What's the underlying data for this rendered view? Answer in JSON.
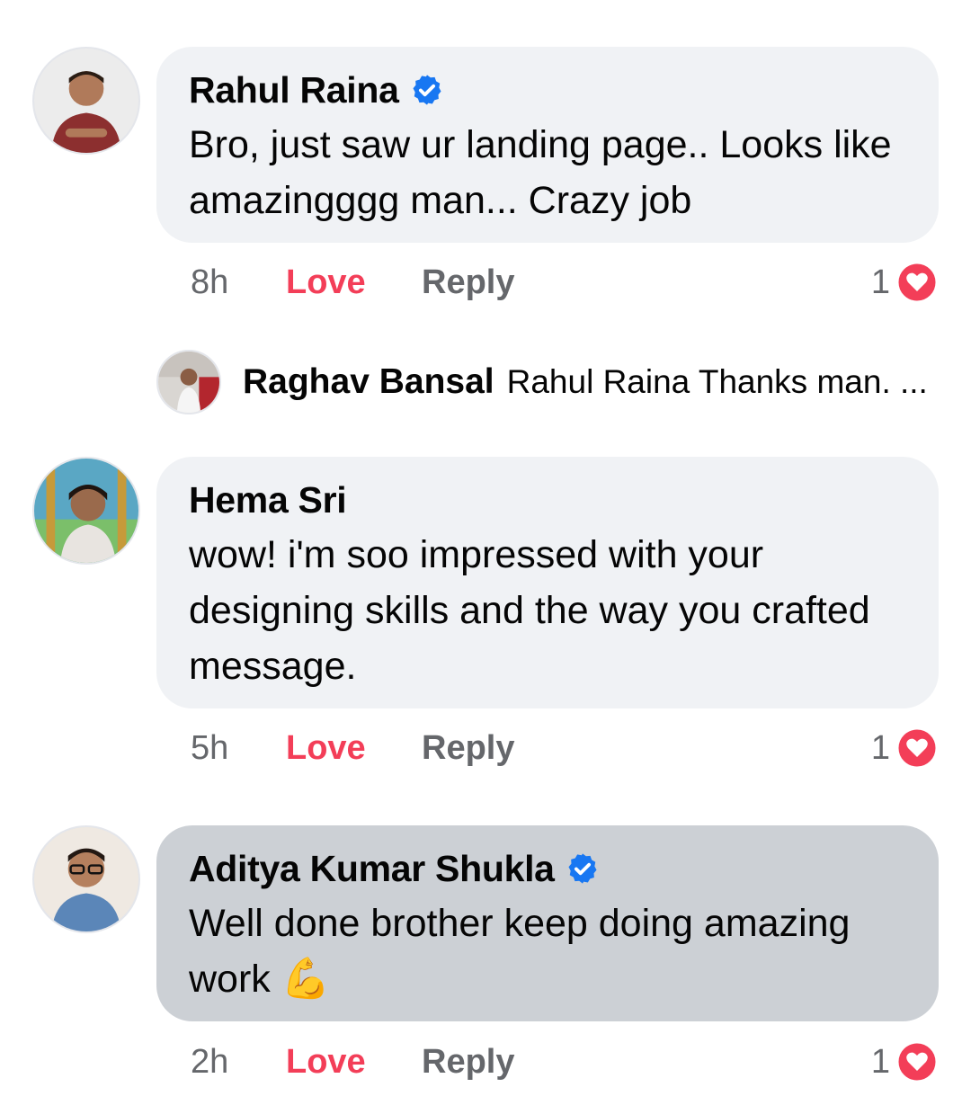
{
  "comments": [
    {
      "author": "Rahul Raina",
      "verified": true,
      "text": "Bro, just saw ur landing page.. Looks like amazingggg man... Crazy job",
      "time": "8h",
      "love_label": "Love",
      "reply_label": "Reply",
      "reaction_count": "1"
    },
    {
      "author": "Hema Sri",
      "verified": false,
      "text": "wow! i'm soo impressed with your designing skills and the way you crafted message.",
      "time": "5h",
      "love_label": "Love",
      "reply_label": "Reply",
      "reaction_count": "1"
    },
    {
      "author": "Aditya Kumar Shukla",
      "verified": true,
      "text": "Well done brother keep doing amazing work",
      "emoji": "💪",
      "time": "2h",
      "love_label": "Love",
      "reply_label": "Reply",
      "reaction_count": "1"
    }
  ],
  "reply_preview": {
    "author": "Raghav Bansal",
    "snippet": "Rahul Raina Thanks man. ..."
  },
  "colors": {
    "bubble": "#f0f2f5",
    "bubble_highlight": "#ccd0d5",
    "love": "#f33e58",
    "muted": "#65676b",
    "verified": "#1877f2"
  }
}
